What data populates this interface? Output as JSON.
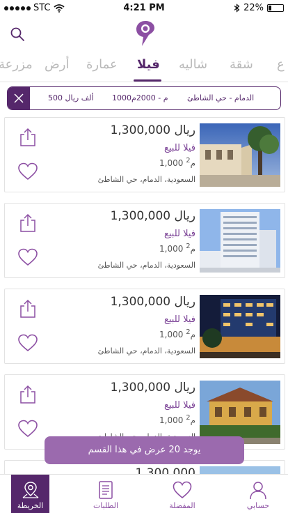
{
  "status_bar": {
    "carrier": "STC",
    "time": "4:21 PM",
    "battery": "22%"
  },
  "header": {
    "logo_icon": "location-pin-logo",
    "search_icon": "search-icon"
  },
  "tabs": [
    {
      "label": "مزرعة",
      "active": false
    },
    {
      "label": "أرض",
      "active": false
    },
    {
      "label": "عمارة",
      "active": false
    },
    {
      "label": "فيلا",
      "active": true
    },
    {
      "label": "شاليه",
      "active": false
    },
    {
      "label": "شقة",
      "active": false
    },
    {
      "label": "ع",
      "active": false
    }
  ],
  "filter": {
    "location": "الدمام - حي الشاطئ",
    "area_range": "1000م - 2000م",
    "price": "500 ألف ريال"
  },
  "listings": [
    {
      "price": "1,300,000 ريال",
      "type": "فيلا للبيع",
      "area": "1,000 م",
      "area_sup": "2",
      "location": "السعودية، الدمام، حي الشاطئ"
    },
    {
      "price": "1,300,000 ريال",
      "type": "فيلا للبيع",
      "area": "1,000 م",
      "area_sup": "2",
      "location": "السعودية، الدمام، حي الشاطئ"
    },
    {
      "price": "1,300,000 ريال",
      "type": "فيلا للبيع",
      "area": "1,000 م",
      "area_sup": "2",
      "location": "السعودية، الدمام، حي الشاطئ"
    },
    {
      "price": "1,300,000 ريال",
      "type": "فيلا للبيع",
      "area": "1,000 م",
      "area_sup": "2",
      "location": "السعودية، الدمام، حي الشاطئ"
    },
    {
      "price": "1,300,000",
      "type": "",
      "area": "",
      "area_sup": "",
      "location": ""
    }
  ],
  "toast": "يوجد 20 عرض في هذا القسم",
  "bottom_nav": [
    {
      "label": "الخريطة",
      "icon": "map-pin-icon",
      "active": true
    },
    {
      "label": "الطلبات",
      "icon": "document-icon",
      "active": false
    },
    {
      "label": "المفضلة",
      "icon": "heart-icon",
      "active": false
    },
    {
      "label": "حسابي",
      "icon": "user-icon",
      "active": false
    }
  ],
  "colors": {
    "brand": "#55276b",
    "accent": "#8c4fa3",
    "toast": "#9b6aae"
  }
}
